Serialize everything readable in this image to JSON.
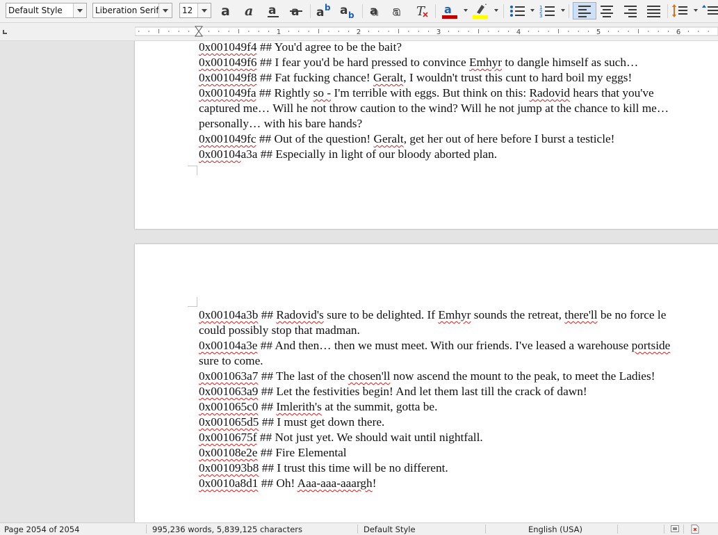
{
  "toolbar": {
    "paragraph_style": "Default Style",
    "font_name": "Liberation Serif",
    "font_size": "12",
    "icons": [
      "bold-icon",
      "italic-icon",
      "underline-icon",
      "strikethrough-icon",
      "superscript-icon",
      "subscript-icon",
      "shadow-icon",
      "outline-icon",
      "clear-formatting-icon",
      "font-color-icon",
      "highlight-icon",
      "bullet-list-icon",
      "numbered-list-icon",
      "align-left-icon",
      "align-center-icon",
      "align-right-icon",
      "justify-icon",
      "line-spacing-icon"
    ],
    "font_color": "#c00000",
    "highlight_color": "#ffff00",
    "accent": "#1c5fb3"
  },
  "ruler": {
    "numbers": [
      "1",
      "2",
      "3",
      "4",
      "5",
      "6"
    ]
  },
  "document": {
    "page1_lines": [
      [
        {
          "t": "0x001049f4",
          "s": true
        },
        {
          "t": " ## You'd agree to be the bait?"
        }
      ],
      [
        {
          "t": "0x001049f6",
          "s": true
        },
        {
          "t": " ## I fear you'd be hard pressed to convince "
        },
        {
          "t": "Emhyr",
          "s": true
        },
        {
          "t": " to dangle himself as such…"
        }
      ],
      [
        {
          "t": "0x001049f8",
          "s": true
        },
        {
          "t": " ## Fat fucking chance! "
        },
        {
          "t": "Geralt",
          "s": true
        },
        {
          "t": ", I wouldn't trust this cunt to hard boil my eggs!"
        }
      ],
      [
        {
          "t": "0x001049fa",
          "s": true
        },
        {
          "t": " ## Rightly "
        },
        {
          "t": "so -",
          "s": true
        },
        {
          "t": " I'm terrible with eggs. But think on this: "
        },
        {
          "t": "Radovid",
          "s": true
        },
        {
          "t": " hears that you've"
        }
      ],
      [
        {
          "t": "captured me… Will he not throw caution to the wind? Will he not jump at the chance to kill me…"
        }
      ],
      [
        {
          "t": "personally… with his bare hands?"
        }
      ],
      [
        {
          "t": "0x001049fc",
          "s": true
        },
        {
          "t": " ## Out of the question! "
        },
        {
          "t": "Geralt",
          "s": true
        },
        {
          "t": ", get her out of here before I burst a testicle!"
        }
      ],
      [
        {
          "t": "0x00104",
          "s": true
        },
        {
          "t": "a3a ## Especially in light of our bloody aborted plan."
        }
      ]
    ],
    "page2_lines": [
      [
        {
          "t": "0x00104a3b",
          "s": true
        },
        {
          "t": " ## "
        },
        {
          "t": "Radovid's",
          "s": true
        },
        {
          "t": " sure to be delighted. If "
        },
        {
          "t": "Emhyr",
          "s": true
        },
        {
          "t": " sounds the retreat, "
        },
        {
          "t": "there'll",
          "s": true
        },
        {
          "t": " be no force le"
        }
      ],
      [
        {
          "t": "could possibly stop that madman."
        }
      ],
      [
        {
          "t": "0x00104a3e",
          "s": true
        },
        {
          "t": " ## And then… then we must meet. With our friends. I've leased a warehouse "
        },
        {
          "t": "portside",
          "s": true
        }
      ],
      [
        {
          "t": "sure to come."
        }
      ],
      [
        {
          "t": "0x001063a7",
          "s": true
        },
        {
          "t": " ## The last of the "
        },
        {
          "t": "chosen'll",
          "s": true
        },
        {
          "t": " now ascend the mount to the peak, to meet the Ladies!"
        }
      ],
      [
        {
          "t": "0x001063a9",
          "s": true
        },
        {
          "t": " ## Let the festivities begin! And let them last till the crack of dawn!"
        }
      ],
      [
        {
          "t": "0x001065c0",
          "s": true
        },
        {
          "t": " ## "
        },
        {
          "t": "Imlerith's",
          "s": true
        },
        {
          "t": " at the summit, gotta be."
        }
      ],
      [
        {
          "t": "0x001065d5",
          "s": true
        },
        {
          "t": " ## I must get down there."
        }
      ],
      [
        {
          "t": "0x0010675f",
          "s": true
        },
        {
          "t": " ## Not just yet. We should wait until nightfall."
        }
      ],
      [
        {
          "t": "0x00108e2e",
          "s": true
        },
        {
          "t": " ## Fire Elemental"
        }
      ],
      [
        {
          "t": "0x001093b8",
          "s": true
        },
        {
          "t": " ## I trust this time will be no different."
        }
      ],
      [
        {
          "t": "0x0010a8d1",
          "s": true
        },
        {
          "t": " ## Oh! "
        },
        {
          "t": "Aaa-aaa-aaargh",
          "s": true
        },
        {
          "t": "!"
        }
      ]
    ]
  },
  "status": {
    "page": "Page 2054 of 2054",
    "words": "995,236 words, 5,839,125 characters",
    "style": "Default Style",
    "language": "English (USA)"
  }
}
